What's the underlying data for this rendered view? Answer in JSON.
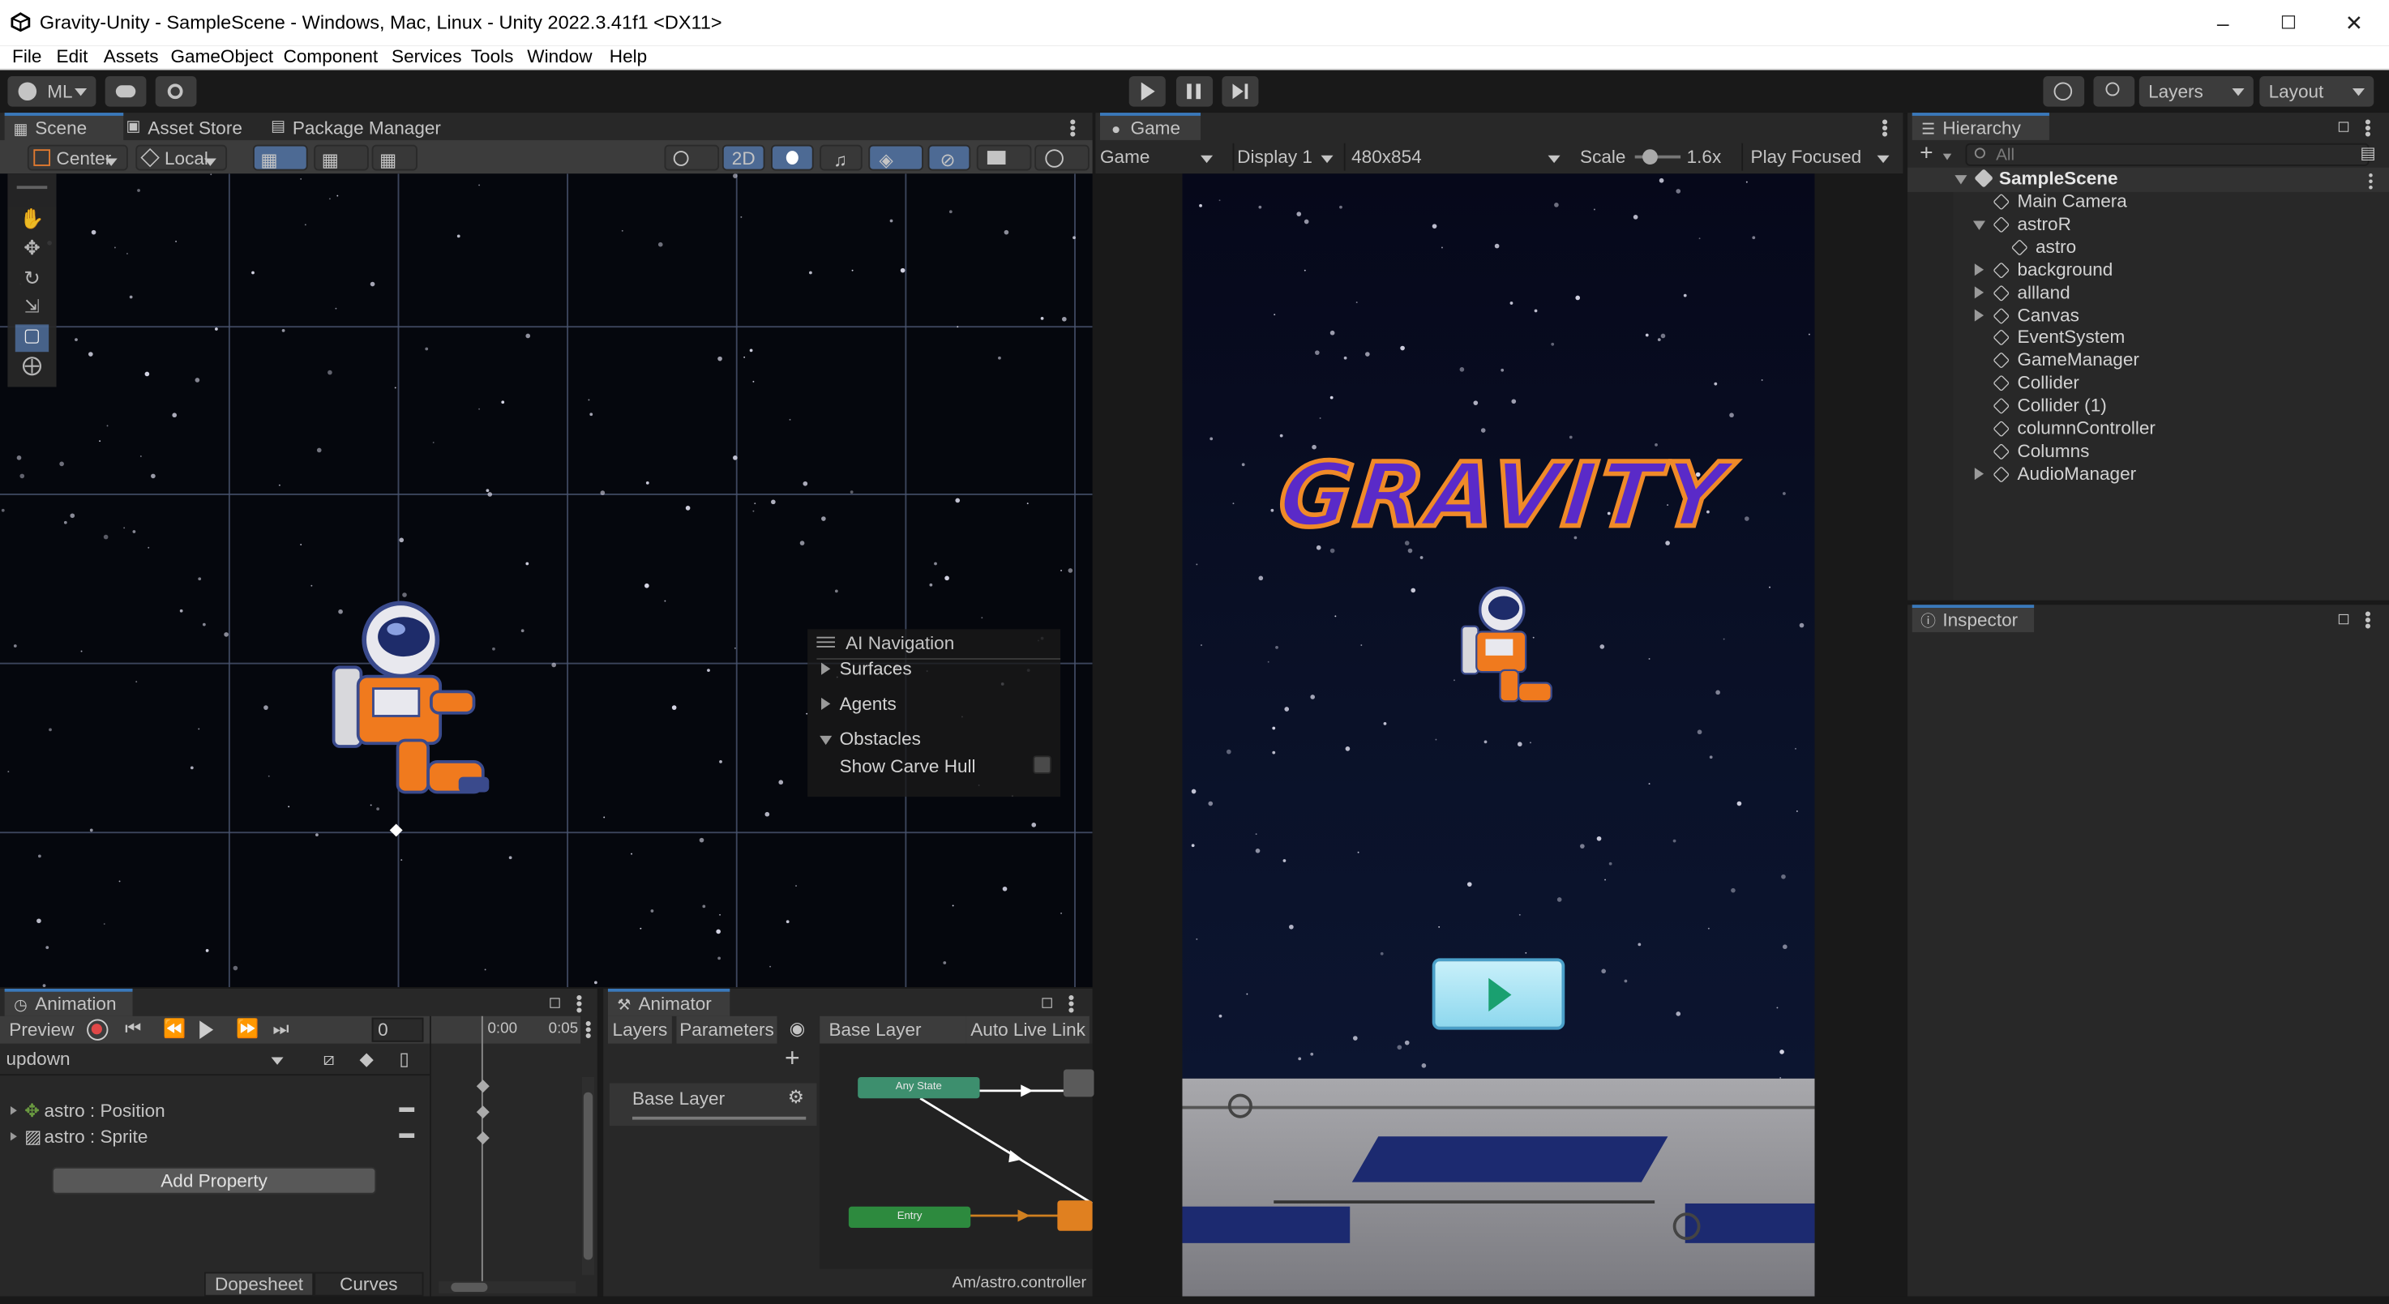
{
  "window": {
    "title": "Gravity-Unity - SampleScene - Windows, Mac, Linux - Unity 2022.3.41f1 <DX11>"
  },
  "menu": [
    "File",
    "Edit",
    "Assets",
    "GameObject",
    "Component",
    "Services",
    "Tools",
    "Window",
    "Help"
  ],
  "toolbar": {
    "account": "ML",
    "layers": "Layers",
    "layout": "Layout"
  },
  "scene_panel": {
    "tabs": [
      "Scene",
      "Asset Store",
      "Package Manager"
    ],
    "pivot": "Center",
    "space": "Local",
    "mode_2d": "2D"
  },
  "ai_navigation": {
    "title": "AI Navigation",
    "items": [
      "Surfaces",
      "Agents",
      "Obstacles"
    ],
    "option": "Show Carve Hull"
  },
  "game_panel": {
    "tab": "Game",
    "mode": "Game",
    "display": "Display 1",
    "resolution": "480x854",
    "scale_label": "Scale",
    "scale_value": "1.6x",
    "play_mode": "Play Focused",
    "logo_text": "GRAVITY"
  },
  "hierarchy": {
    "title": "Hierarchy",
    "search_placeholder": "All",
    "scene": "SampleScene",
    "items": [
      {
        "label": "Main Camera",
        "indent": 1,
        "expander": "none"
      },
      {
        "label": "astroR",
        "indent": 1,
        "expander": "open"
      },
      {
        "label": "astro",
        "indent": 2,
        "expander": "none"
      },
      {
        "label": "background",
        "indent": 1,
        "expander": "closed"
      },
      {
        "label": "allland",
        "indent": 1,
        "expander": "closed"
      },
      {
        "label": "Canvas",
        "indent": 1,
        "expander": "closed"
      },
      {
        "label": "EventSystem",
        "indent": 1,
        "expander": "none"
      },
      {
        "label": "GameManager",
        "indent": 1,
        "expander": "none"
      },
      {
        "label": "Collider",
        "indent": 1,
        "expander": "none"
      },
      {
        "label": "Collider (1)",
        "indent": 1,
        "expander": "none"
      },
      {
        "label": "columnController",
        "indent": 1,
        "expander": "none"
      },
      {
        "label": "Columns",
        "indent": 1,
        "expander": "none"
      },
      {
        "label": "AudioManager",
        "indent": 1,
        "expander": "closed"
      }
    ]
  },
  "inspector": {
    "title": "Inspector"
  },
  "animation": {
    "title": "Animation",
    "preview": "Preview",
    "frame": "0",
    "clip": "updown",
    "time_start": "0:00",
    "time_end": "0:05",
    "properties": [
      "astro : Position",
      "astro : Sprite"
    ],
    "add_property": "Add Property",
    "dopesheet": "Dopesheet",
    "curves": "Curves"
  },
  "animator": {
    "title": "Animator",
    "tab_layers": "Layers",
    "tab_parameters": "Parameters",
    "breadcrumb": "Base Layer",
    "auto_live_link": "Auto Live Link",
    "layer_name": "Base Layer",
    "state_any": "Any State",
    "state_entry": "Entry",
    "controller_path": "Am/astro.controller"
  },
  "colors": {
    "accent": "#3a79bb",
    "orange": "#f07a1e",
    "any_state": "#3d8f6e",
    "entry": "#2d8a3e"
  }
}
